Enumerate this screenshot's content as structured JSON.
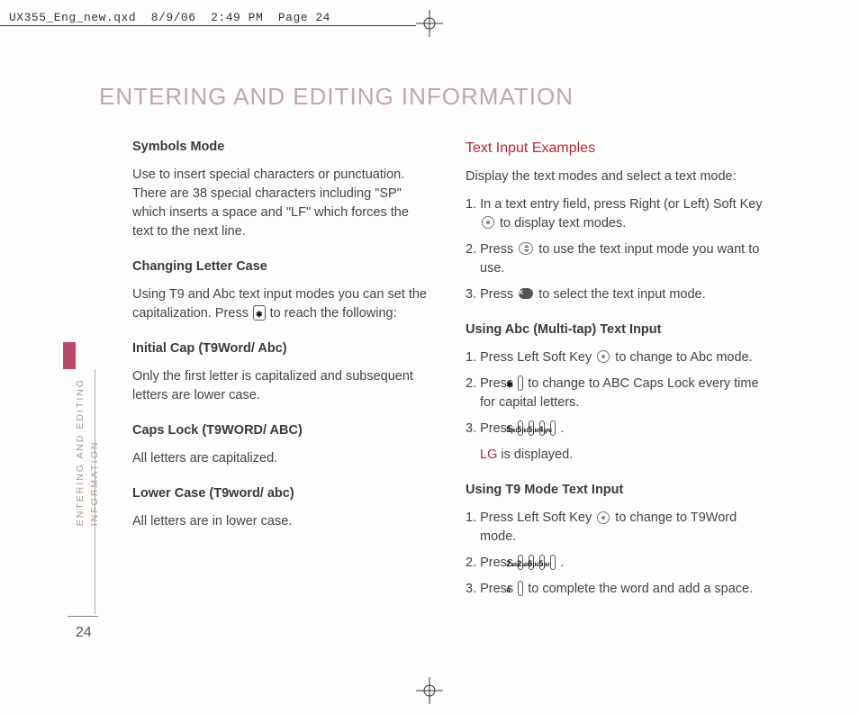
{
  "doc_header": "UX355_Eng_new.qxd  8/9/06  2:49 PM  Page 24",
  "side_label": "ENTERING AND EDITING\nINFORMATION",
  "page_number": "24",
  "chapter_title": "ENTERING AND EDITING INFORMATION",
  "left": {
    "h1": "Symbols Mode",
    "p1": "Use to insert special characters or punctuation. There are 38 special characters including \"SP\" which inserts a space and \"LF\" which forces the text to the next line.",
    "h2": "Changing Letter Case",
    "p2a": "Using T9 and Abc text input modes you can set the capitalization. Press ",
    "p2b": " to reach the following:",
    "h3": "Initial Cap (T9Word/ Abc)",
    "p3": "Only the first letter is capitalized and subsequent letters are lower case.",
    "h4": "Caps Lock (T9WORD/ ABC)",
    "p4": "All letters are capitalized.",
    "h5": "Lower Case (T9word/ abc)",
    "p5": "All letters are in lower case."
  },
  "right": {
    "h1": "Text Input Examples",
    "p1": "Display the text modes and select a text mode:",
    "s1a": "1. In a text entry field, press Right (or Left) Soft Key ",
    "s1b": " to display text modes.",
    "s2a": "2. Press ",
    "s2b": " to use the text input mode you want to use.",
    "s3a": "3. Press ",
    "s3b": " to select the text input mode.",
    "h2": "Using Abc (Multi-tap) Text Input",
    "a1a": "1. Press Left Soft Key ",
    "a1b": " to change to Abc mode.",
    "a2a": "2. Press ",
    "a2b": " to change to ABC Caps Lock every time for capital letters.",
    "a3a": "3. Press ",
    "a3b": ".",
    "a3_lg": "LG",
    "a3_disp": " is displayed.",
    "h3": "Using T9 Mode Text Input",
    "t1a": "1. Press Left Soft Key ",
    "t1b": " to change to T9Word mode.",
    "t2a": "2. Press ",
    "t2b": ".",
    "t3a": "3. Press ",
    "t3b": " to complete the word and add a space."
  },
  "keys": {
    "star": {
      "main": "✱",
      "sub": ""
    },
    "hash": {
      "main": "#",
      "sub": ""
    },
    "k2": {
      "main": "2",
      "sub": "abc"
    },
    "k4": {
      "main": "4",
      "sub": "ghi"
    },
    "k5": {
      "main": "5",
      "sub": "jkl"
    },
    "ok": "OK"
  }
}
